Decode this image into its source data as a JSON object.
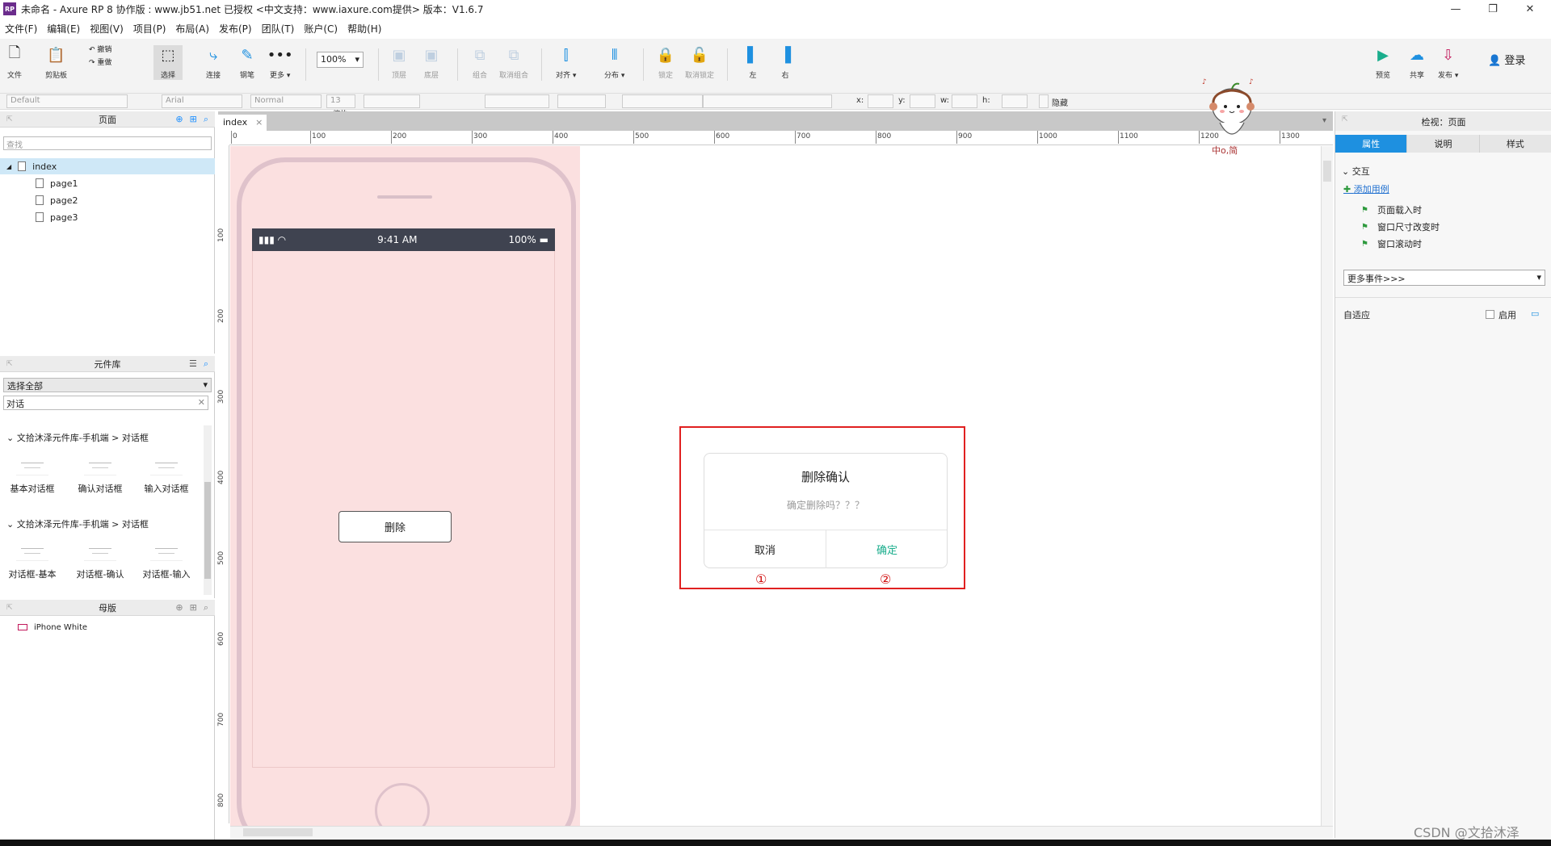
{
  "window": {
    "title": "未命名 - Axure RP 8 协作版 : www.jb51.net  已授权      <中文支持：www.iaxure.com提供> 版本：V1.6.7",
    "app_icon": "RP",
    "minimize": "—",
    "restore": "❐",
    "close": "✕"
  },
  "menubar": [
    "文件(F)",
    "编辑(E)",
    "视图(V)",
    "项目(P)",
    "布局(A)",
    "发布(P)",
    "团队(T)",
    "账户(C)",
    "帮助(H)"
  ],
  "toolbar": {
    "file": "文件",
    "clipboard": "剪贴板",
    "undo": "撤销",
    "redo": "重做",
    "select": "选择",
    "connect": "连接",
    "pen": "钢笔",
    "more": "更多 ▾",
    "zoom_value": "100%",
    "zoom": "缩放",
    "top": "顶层",
    "bottom": "底层",
    "group": "组合",
    "ungroup": "取消组合",
    "align": "对齐 ▾",
    "distribute": "分布 ▾",
    "lock": "锁定",
    "unlock": "取消锁定",
    "left": "左",
    "right": "右",
    "preview": "预览",
    "share": "共享",
    "publish": "发布 ▾",
    "login": "登录"
  },
  "formatbar": {
    "style": "Default",
    "font": "Arial",
    "weight": "Normal",
    "size": "13",
    "x": "x:",
    "y": "y:",
    "w": "w:",
    "h": "h:",
    "hidden": "隐藏"
  },
  "pages_panel": {
    "title": "页面",
    "search_placeholder": "查找",
    "items": [
      "index",
      "page1",
      "page2",
      "page3"
    ]
  },
  "library_panel": {
    "title": "元件库",
    "selector": "选择全部",
    "search": "对话",
    "groups": [
      {
        "name": "文拾沐泽元件库-手机端 > 对话框",
        "items": [
          "基本对话框",
          "确认对话框",
          "输入对话框"
        ]
      },
      {
        "name": "文拾沐泽元件库-手机端 > 对话框",
        "items": [
          "对话框-基本",
          "对话框-确认",
          "对话框-输入"
        ]
      }
    ]
  },
  "masters_panel": {
    "title": "母版",
    "items": [
      "iPhone White"
    ]
  },
  "canvas": {
    "tab": "index",
    "ruler_top": [
      "0",
      "100",
      "200",
      "300",
      "400",
      "500",
      "600",
      "700",
      "800",
      "900",
      "1000",
      "1100",
      "1200",
      "1300"
    ],
    "ruler_left": [
      "100",
      "200",
      "300",
      "400",
      "500",
      "600",
      "700",
      "800"
    ],
    "phone_status": {
      "time": "9:41 AM",
      "battery": "100%"
    },
    "delete_button": "删除",
    "dialog": {
      "title": "删除确认",
      "message": "确定删除吗？？？",
      "cancel": "取消",
      "confirm": "确定",
      "marker1": "①",
      "marker2": "②",
      "confirm_color": "#1aad8c",
      "outline_color": "#e02020"
    }
  },
  "right_panel": {
    "title": "检视：页面",
    "tabs": [
      "属性",
      "说明",
      "样式"
    ],
    "section": "交互",
    "add_case": "添加用例",
    "events": [
      "页面载入时",
      "窗口尺寸改变时",
      "窗口滚动时"
    ],
    "more_events": "更多事件>>>",
    "adaptive": "自适应",
    "enable": "启用"
  },
  "mascot_text": "中o,简",
  "watermark": "CSDN @文拾沐泽",
  "accent_color": "#1e90e0"
}
